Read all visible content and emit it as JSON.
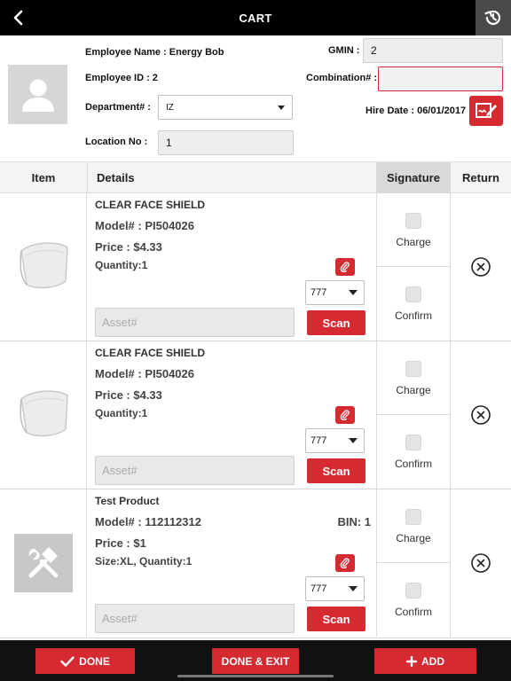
{
  "header": {
    "title": "CART",
    "back_icon": "chevron-left-icon",
    "history_icon": "history-icon"
  },
  "employee": {
    "name_label": "Employee Name : Energy Bob",
    "id_label": "Employee ID : 2",
    "department_label": "Department# :",
    "department_value": "IZ",
    "location_label": "Location No :",
    "location_value": "1",
    "gmin_label": "GMIN :",
    "gmin_value": "2",
    "combination_label": "Combination# :",
    "combination_value": "",
    "hire_date_label": "Hire Date : 06/01/2017"
  },
  "table": {
    "headers": {
      "item": "Item",
      "details": "Details",
      "signature": "Signature",
      "return": "Return"
    }
  },
  "items": [
    {
      "name": "CLEAR FACE SHIELD",
      "model": "Model# : PI504026",
      "bin": "",
      "price": "Price : $4.33",
      "quantity": "Quantity:1",
      "dropdown": "777",
      "asset_placeholder": "Asset#",
      "scan_label": "Scan",
      "charge_label": "Charge",
      "confirm_label": "Confirm",
      "image": "face-shield"
    },
    {
      "name": "CLEAR FACE SHIELD",
      "model": "Model# : PI504026",
      "bin": "",
      "price": "Price : $4.33",
      "quantity": "Quantity:1",
      "dropdown": "777",
      "asset_placeholder": "Asset#",
      "scan_label": "Scan",
      "charge_label": "Charge",
      "confirm_label": "Confirm",
      "image": "face-shield"
    },
    {
      "name": "Test Product",
      "model": "Model# : 112112312",
      "bin": "BIN: 1",
      "price": "Price : $1",
      "quantity": "Size:XL, Quantity:1",
      "dropdown": "777",
      "asset_placeholder": "Asset#",
      "scan_label": "Scan",
      "charge_label": "Charge",
      "confirm_label": "Confirm",
      "image": "tools-icon"
    }
  ],
  "footer": {
    "done_label": "DONE",
    "done_exit_label": "DONE & EXIT",
    "add_label": "ADD"
  },
  "colors": {
    "accent": "#d62a33",
    "topbar": "#000000",
    "bottombar": "#111111"
  }
}
